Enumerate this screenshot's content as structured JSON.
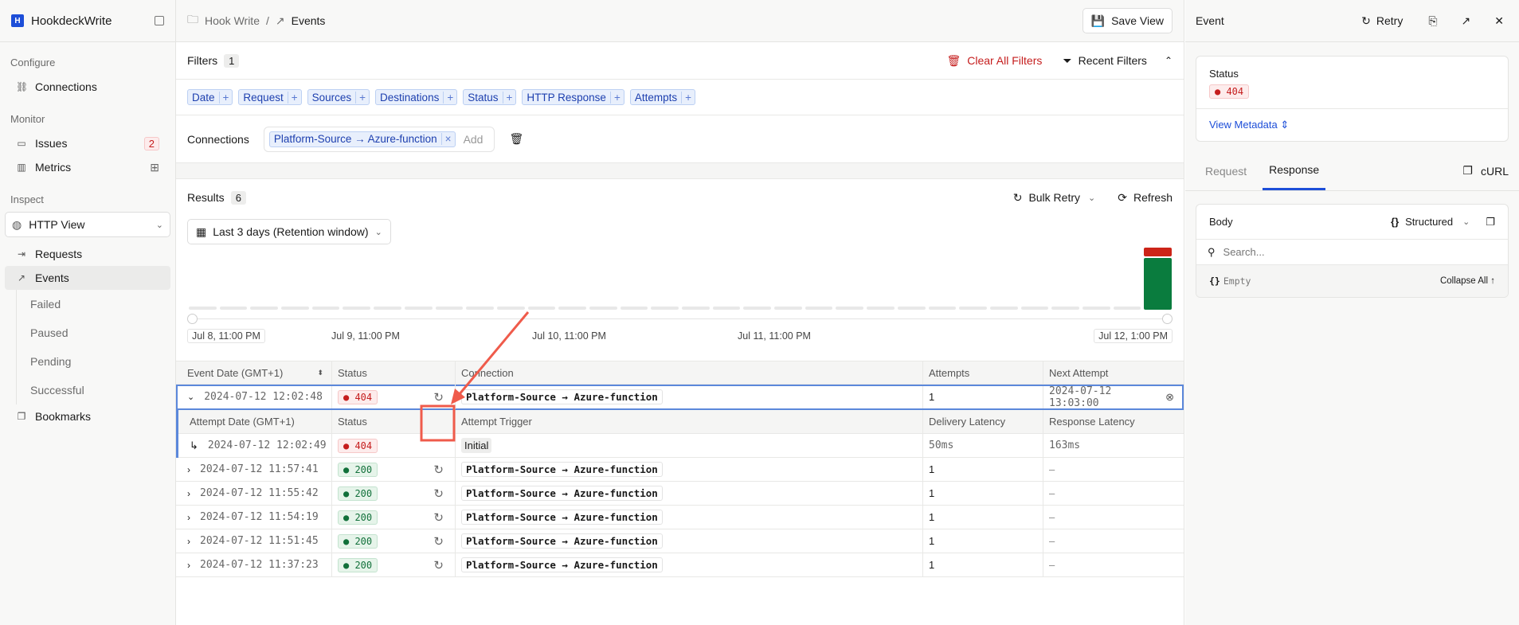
{
  "sidebar": {
    "app_name": "HookdeckWrite",
    "configure": "Configure",
    "connections": "Connections",
    "monitor": "Monitor",
    "issues": "Issues",
    "issues_count": "2",
    "metrics": "Metrics",
    "inspect": "Inspect",
    "view_select": "HTTP View",
    "requests": "Requests",
    "events": "Events",
    "sub": [
      "Failed",
      "Paused",
      "Pending",
      "Successful"
    ],
    "bookmarks": "Bookmarks"
  },
  "header": {
    "project": "Hook Write",
    "sep": "/",
    "page": "Events",
    "save_view": "Save View"
  },
  "filters": {
    "label": "Filters",
    "count": "1",
    "clear": "Clear All Filters",
    "recent": "Recent Filters",
    "chips": [
      "Date",
      "Request",
      "Sources",
      "Destinations",
      "Status",
      "HTTP Response",
      "Attempts"
    ],
    "plus": "+",
    "connections_label": "Connections",
    "connection_value": "Platform-Source → Azure-function",
    "add": "Add"
  },
  "results": {
    "label": "Results",
    "count": "6",
    "bulk_retry": "Bulk Retry",
    "refresh": "Refresh",
    "range": "Last 3 days (Retention window)",
    "axis": [
      "Jul 8, 11:00 PM",
      "Jul 9, 11:00 PM",
      "Jul 10, 11:00 PM",
      "Jul 11, 11:00 PM",
      "Jul 12, 1:00 PM"
    ],
    "histogram": {
      "buckets": 32,
      "last_success": 5,
      "last_failed": 1,
      "colors": {
        "success": "#0a7c3e",
        "failed": "#cc2418",
        "empty": "#e8e8e8"
      }
    }
  },
  "table": {
    "headers": [
      "Event Date (GMT+1)",
      "Status",
      "Connection",
      "Attempts",
      "Next Attempt"
    ],
    "expanded": {
      "date": "2024-07-12 12:02:48",
      "status": "404",
      "connection": "Platform-Source → Azure-function",
      "attempts": "1",
      "next": "2024-07-12 13:03:00"
    },
    "attempt_headers": [
      "Attempt Date (GMT+1)",
      "Status",
      "Attempt Trigger",
      "Delivery Latency",
      "Response Latency"
    ],
    "attempt": {
      "date": "2024-07-12 12:02:49",
      "status": "404",
      "trigger": "Initial",
      "delivery": "50ms",
      "response": "163ms"
    },
    "rows": [
      {
        "date": "2024-07-12 11:57:41",
        "status": "200",
        "connection": "Platform-Source → Azure-function",
        "attempts": "1",
        "next": "–"
      },
      {
        "date": "2024-07-12 11:55:42",
        "status": "200",
        "connection": "Platform-Source → Azure-function",
        "attempts": "1",
        "next": "–"
      },
      {
        "date": "2024-07-12 11:54:19",
        "status": "200",
        "connection": "Platform-Source → Azure-function",
        "attempts": "1",
        "next": "–"
      },
      {
        "date": "2024-07-12 11:51:45",
        "status": "200",
        "connection": "Platform-Source → Azure-function",
        "attempts": "1",
        "next": "–"
      },
      {
        "date": "2024-07-12 11:37:23",
        "status": "200",
        "connection": "Platform-Source → Azure-function",
        "attempts": "1",
        "next": "–"
      }
    ]
  },
  "panel": {
    "title": "Event",
    "retry": "Retry",
    "status_label": "Status",
    "status": "404",
    "view_metadata": "View Metadata",
    "tabs": [
      "Request",
      "Response"
    ],
    "curl": "cURL",
    "body": "Body",
    "format": "Structured",
    "search_placeholder": "Search...",
    "empty": "Empty",
    "collapse_all": "Collapse All ↑"
  }
}
